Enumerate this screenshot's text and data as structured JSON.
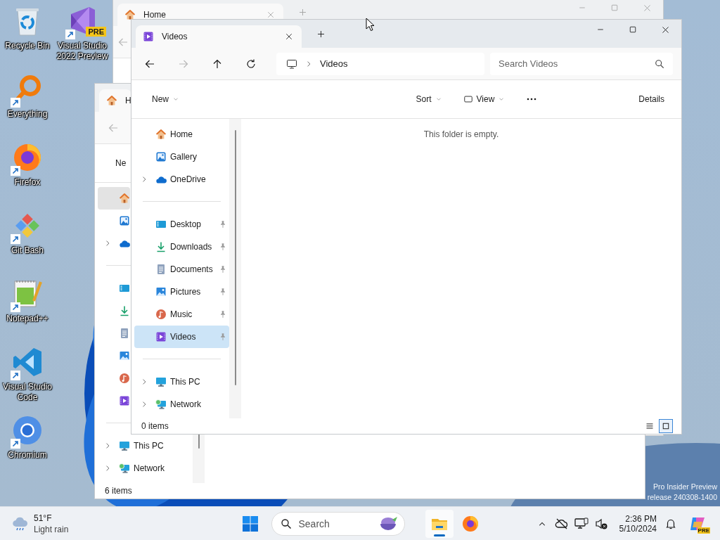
{
  "desktop": {
    "shortcuts": [
      {
        "label": "Recycle Bin",
        "kind": "recycle",
        "shortcut": false
      },
      {
        "label": "Everything",
        "kind": "everything",
        "shortcut": true
      },
      {
        "label": "Firefox",
        "kind": "firefox",
        "shortcut": true
      },
      {
        "label": "Git Bash",
        "kind": "gitbash",
        "shortcut": true
      },
      {
        "label": "Notepad++",
        "kind": "notepadpp",
        "shortcut": true
      },
      {
        "label": "Visual Studio Code",
        "kind": "vscode",
        "shortcut": true
      },
      {
        "label": "Chromium",
        "kind": "chromium",
        "shortcut": true
      },
      {
        "label": "Visual Studio 2022 Preview",
        "kind": "vs",
        "shortcut": true,
        "badge": "PRE"
      }
    ],
    "os_watermark": [
      "Pro Insider Preview",
      "release 240308-1400"
    ]
  },
  "windows": [
    {
      "active": false,
      "tab": {
        "label": "Home",
        "kind": "home"
      },
      "nav": [
        {
          "kind": "back",
          "disabled": true
        }
      ]
    },
    {
      "active": false,
      "tab": {
        "label": "H",
        "kind": "home"
      },
      "nav": [
        {
          "kind": "back",
          "disabled": true
        }
      ],
      "commands": [
        {
          "kind": "new",
          "label": "Ne"
        }
      ],
      "sidebar": [
        [
          {
            "kind": "home",
            "selected": true,
            "expandable": false
          },
          {
            "kind": "gallery",
            "selected": false,
            "expandable": false
          },
          {
            "kind": "onedrive",
            "selected": false,
            "expandable": true
          }
        ],
        [
          {
            "kind": "desktop",
            "selected": false,
            "expandable": false
          },
          {
            "kind": "downloads",
            "selected": false,
            "expandable": false
          },
          {
            "kind": "documents",
            "selected": false,
            "expandable": false
          },
          {
            "kind": "pictures",
            "selected": false,
            "expandable": false
          },
          {
            "kind": "music",
            "selected": false,
            "expandable": false
          },
          {
            "kind": "videos",
            "selected": false,
            "expandable": false
          }
        ],
        [
          {
            "kind": "pc",
            "label": "This PC",
            "selected": false,
            "expandable": true
          },
          {
            "kind": "network",
            "label": "Network",
            "selected": false,
            "expandable": true
          }
        ]
      ],
      "status": "6 items"
    },
    {
      "active": true,
      "tab": {
        "label": "Videos",
        "kind": "videos"
      },
      "nav": [
        {
          "kind": "back",
          "disabled": false
        },
        {
          "kind": "forward",
          "disabled": true
        },
        {
          "kind": "up",
          "disabled": false
        },
        {
          "kind": "refresh",
          "disabled": false
        }
      ],
      "address": {
        "segments": [
          "Videos"
        ]
      },
      "search": {
        "placeholder": "Search Videos"
      },
      "commands": [
        {
          "kind": "new",
          "label": "New",
          "dropdown": true
        },
        {
          "kind": "sort",
          "label": "Sort",
          "dropdown": true
        },
        {
          "kind": "view",
          "label": "View",
          "dropdown": true
        },
        {
          "kind": "more"
        },
        {
          "kind": "details",
          "label": "Details"
        }
      ],
      "sidebar": [
        [
          {
            "kind": "home",
            "label": "Home",
            "selected": false,
            "expandable": false,
            "pinned": false
          },
          {
            "kind": "gallery",
            "label": "Gallery",
            "selected": false,
            "expandable": false,
            "pinned": false
          },
          {
            "kind": "onedrive",
            "label": "OneDrive",
            "selected": false,
            "expandable": true,
            "pinned": false
          }
        ],
        [
          {
            "kind": "desktop",
            "label": "Desktop",
            "selected": false,
            "expandable": false,
            "pinned": true
          },
          {
            "kind": "downloads",
            "label": "Downloads",
            "selected": false,
            "expandable": false,
            "pinned": true
          },
          {
            "kind": "documents",
            "label": "Documents",
            "selected": false,
            "expandable": false,
            "pinned": true
          },
          {
            "kind": "pictures",
            "label": "Pictures",
            "selected": false,
            "expandable": false,
            "pinned": true
          },
          {
            "kind": "music",
            "label": "Music",
            "selected": false,
            "expandable": false,
            "pinned": true
          },
          {
            "kind": "videos",
            "label": "Videos",
            "selected": true,
            "expandable": false,
            "pinned": true
          }
        ],
        [
          {
            "kind": "pc",
            "label": "This PC",
            "selected": false,
            "expandable": true,
            "pinned": false
          },
          {
            "kind": "network",
            "label": "Network",
            "selected": false,
            "expandable": true,
            "pinned": false
          }
        ]
      ],
      "empty_message": "This folder is empty.",
      "status": "0 items",
      "view_modes": [
        {
          "kind": "list",
          "selected": false
        },
        {
          "kind": "tiles",
          "selected": true
        }
      ]
    }
  ],
  "taskbar": {
    "weather": {
      "temperature": "51°F",
      "condition": "Light rain"
    },
    "search": {
      "placeholder": "Search"
    },
    "apps": [
      {
        "kind": "explorer",
        "selected": true
      },
      {
        "kind": "firefox",
        "selected": false
      }
    ],
    "clock": {
      "time": "2:36 PM",
      "date": "5/10/2024"
    },
    "copilot_badge": "PRE"
  }
}
